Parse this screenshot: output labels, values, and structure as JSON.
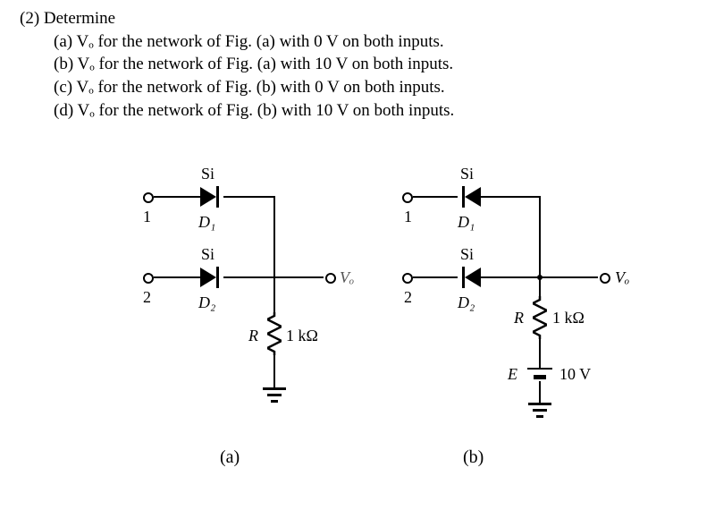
{
  "problem": {
    "number": "(2)",
    "stem": "Determine",
    "parts": [
      "(a) Vₒ for the network of Fig. (a) with 0 V on both inputs.",
      "(b) Vₒ for the network of Fig. (a) with 10 V on both inputs.",
      "(c) Vₒ for the network of Fig. (b) with 0 V on both inputs.",
      "(d) Vₒ for the network of Fig. (b) with 10 V on both inputs."
    ]
  },
  "circuit_a": {
    "fig_label": "(a)",
    "inputs": {
      "in1": "1",
      "in2": "2"
    },
    "diodes": {
      "d1": {
        "ref": "D₁",
        "material": "Si",
        "direction": "anode_left"
      },
      "d2": {
        "ref": "D₂",
        "material": "Si",
        "direction": "anode_left"
      }
    },
    "output": "Vₒ",
    "resistor": {
      "ref": "R",
      "value": "1 kΩ"
    },
    "ground": true
  },
  "circuit_b": {
    "fig_label": "(b)",
    "inputs": {
      "in1": "1",
      "in2": "2"
    },
    "diodes": {
      "d1": {
        "ref": "D₁",
        "material": "Si",
        "direction": "cathode_left"
      },
      "d2": {
        "ref": "D₂",
        "material": "Si",
        "direction": "cathode_left"
      }
    },
    "output": "Vₒ",
    "resistor": {
      "ref": "R",
      "value": "1 kΩ"
    },
    "source": {
      "ref": "E",
      "value": "10 V"
    },
    "ground": true
  },
  "chart_data": {
    "type": "diagram",
    "figures": [
      {
        "id": "a",
        "topology": "OR-gate style: two Si diodes from inputs 1 and 2 (anode at input, cathode at output node Vₒ); output node to ground through R = 1 kΩ"
      },
      {
        "id": "b",
        "topology": "AND-gate style: two Si diodes from inputs 1 and 2 (cathode at input, anode at output node Vₒ); output node through R = 1 kΩ to source E = 10 V, then to ground"
      }
    ]
  }
}
